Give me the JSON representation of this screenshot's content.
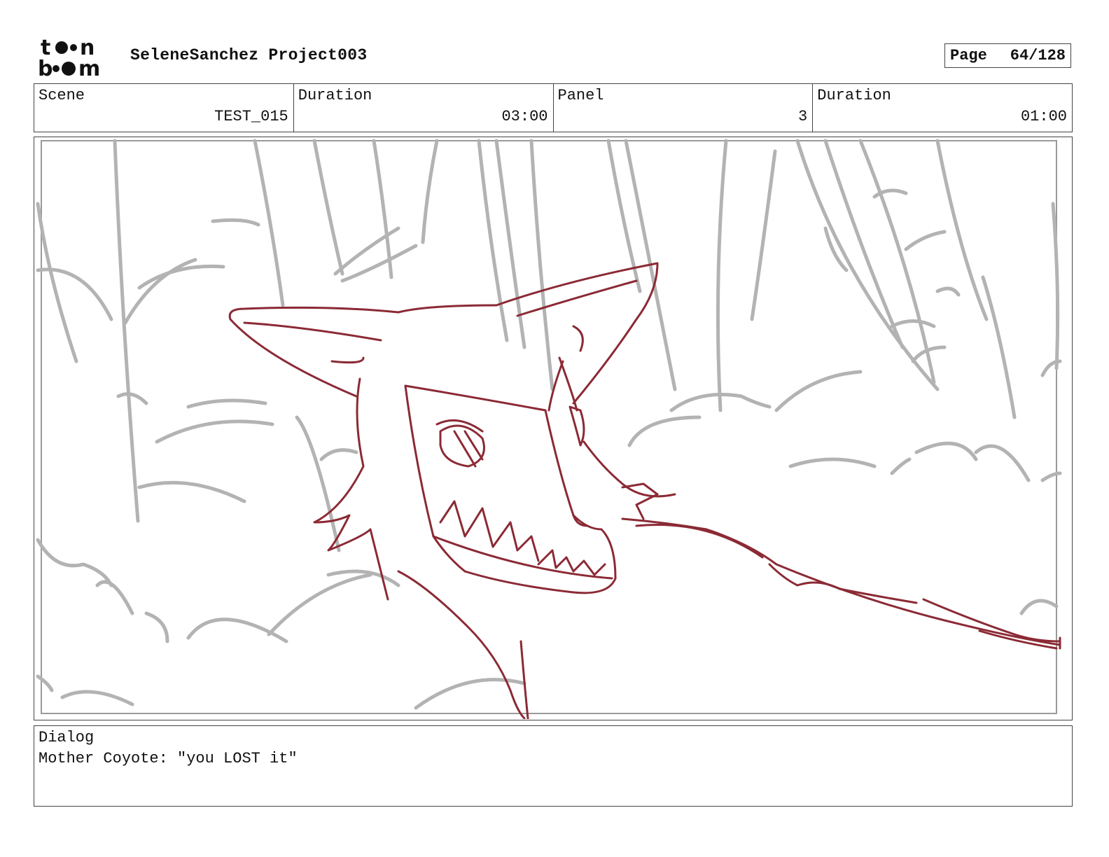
{
  "header": {
    "logo_text_top": "toon",
    "logo_text_bottom": "boom",
    "project_title": "SeleneSanchez Project003",
    "page_label": "Page",
    "page_value": "64/128"
  },
  "info": {
    "scene_label": "Scene",
    "scene_value": "TEST_015",
    "scene_duration_label": "Duration",
    "scene_duration_value": "03:00",
    "panel_label": "Panel",
    "panel_value": "3",
    "panel_duration_label": "Duration",
    "panel_duration_value": "01:00"
  },
  "panel": {
    "sketch_subject": "coyote-head-sketch",
    "background_color": "#b3b3b3",
    "character_color": "#8b2a35"
  },
  "dialog": {
    "label": "Dialog",
    "text": "Mother Coyote: \"you LOST it\""
  }
}
